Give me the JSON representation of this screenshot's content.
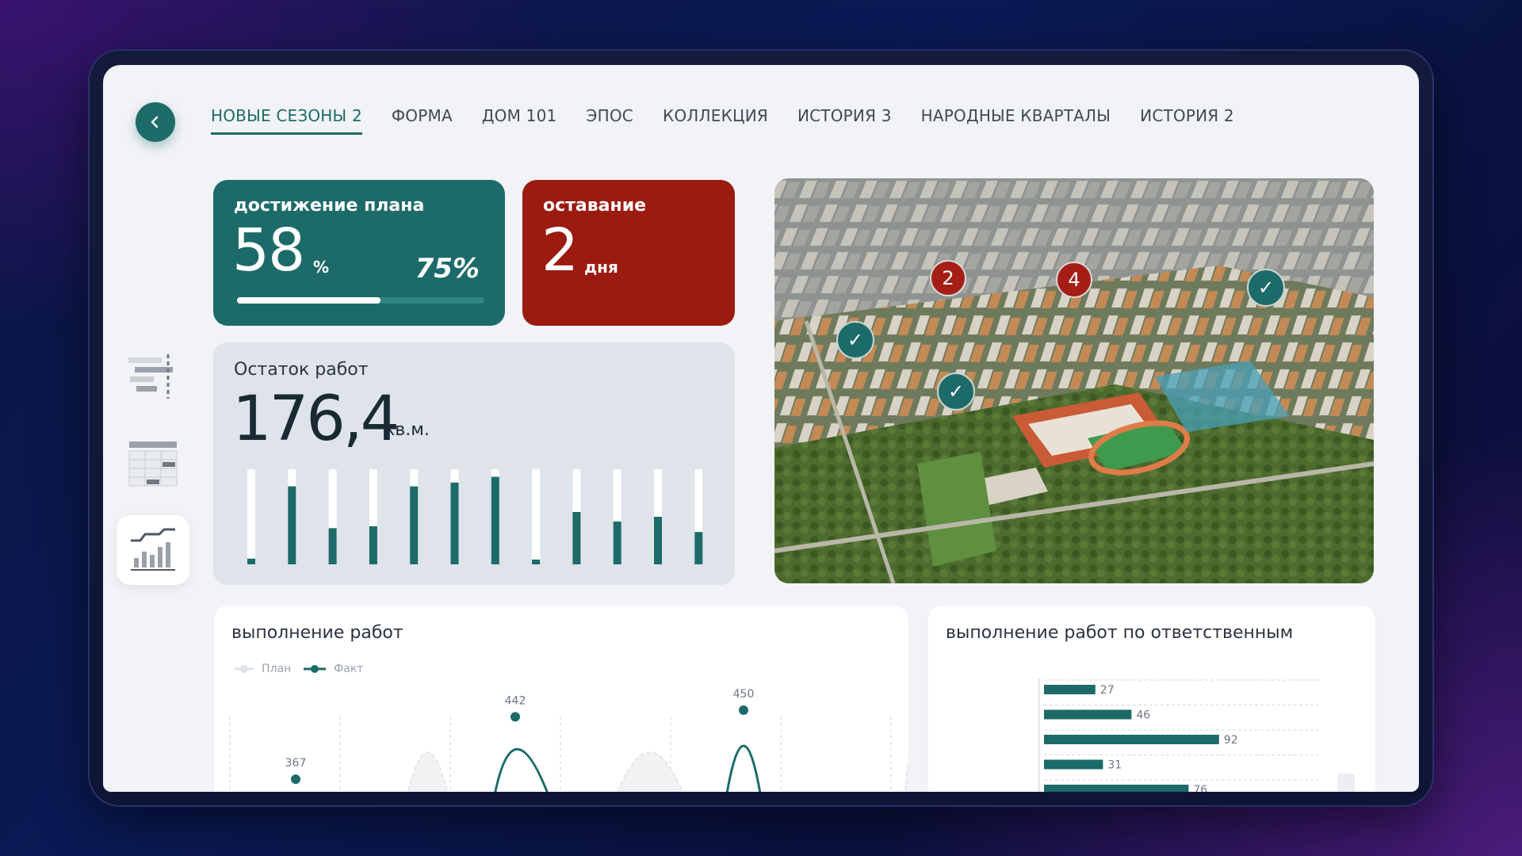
{
  "nav": {
    "back_icon": "chevron-left-icon",
    "tabs": [
      {
        "label": "НОВЫЕ СЕЗОНЫ 2",
        "active": true
      },
      {
        "label": "ФОРМА",
        "active": false
      },
      {
        "label": "ДОМ 101",
        "active": false
      },
      {
        "label": "ЭПОС",
        "active": false
      },
      {
        "label": "КОЛЛЕКЦИЯ",
        "active": false
      },
      {
        "label": "ИСТОРИЯ 3",
        "active": false
      },
      {
        "label": "НАРОДНЫЕ КВАРТАЛЫ",
        "active": false
      },
      {
        "label": "ИСТОРИЯ 2",
        "active": false
      }
    ]
  },
  "sidebar": {
    "items": [
      {
        "icon": "gantt-icon",
        "active": false
      },
      {
        "icon": "table-icon",
        "active": false
      },
      {
        "icon": "chart-icon",
        "active": true
      }
    ]
  },
  "plan": {
    "label": "достижение плана",
    "value": "58",
    "unit": "%",
    "target": "75%",
    "progress": 0.58
  },
  "lag": {
    "label": "оставание",
    "value": "2",
    "unit": "дня"
  },
  "remaining": {
    "label": "Остаток работ",
    "value": "176,4",
    "unit": "кв.м.",
    "bar_fills": [
      0.06,
      0.82,
      0.38,
      0.4,
      0.82,
      0.86,
      0.92,
      0.05,
      0.55,
      0.45,
      0.5,
      0.34
    ]
  },
  "map": {
    "markers": [
      {
        "label": "2",
        "status": "warning"
      },
      {
        "label": "4",
        "status": "warning"
      },
      {
        "label": "✓",
        "status": "done"
      },
      {
        "label": "✓",
        "status": "done"
      },
      {
        "label": "✓",
        "status": "done"
      }
    ]
  },
  "works": {
    "title": "выполнение работ",
    "legend": [
      {
        "label": "План"
      },
      {
        "label": "Факт"
      }
    ],
    "chart_data": {
      "type": "line",
      "series": [
        {
          "name": "Факт",
          "points": [
            {
              "label": "367",
              "value": 367
            },
            {
              "label": "442",
              "value": 442
            },
            {
              "label": "450",
              "value": 450
            }
          ]
        }
      ]
    }
  },
  "responsible": {
    "title": "выполнение работ по ответственным",
    "chart_data": {
      "type": "bar",
      "values": [
        27,
        46,
        92,
        31,
        76
      ]
    }
  },
  "colors": {
    "accent": "#1d6b69",
    "danger": "#9b1b10",
    "background": "#f2f3f6"
  }
}
